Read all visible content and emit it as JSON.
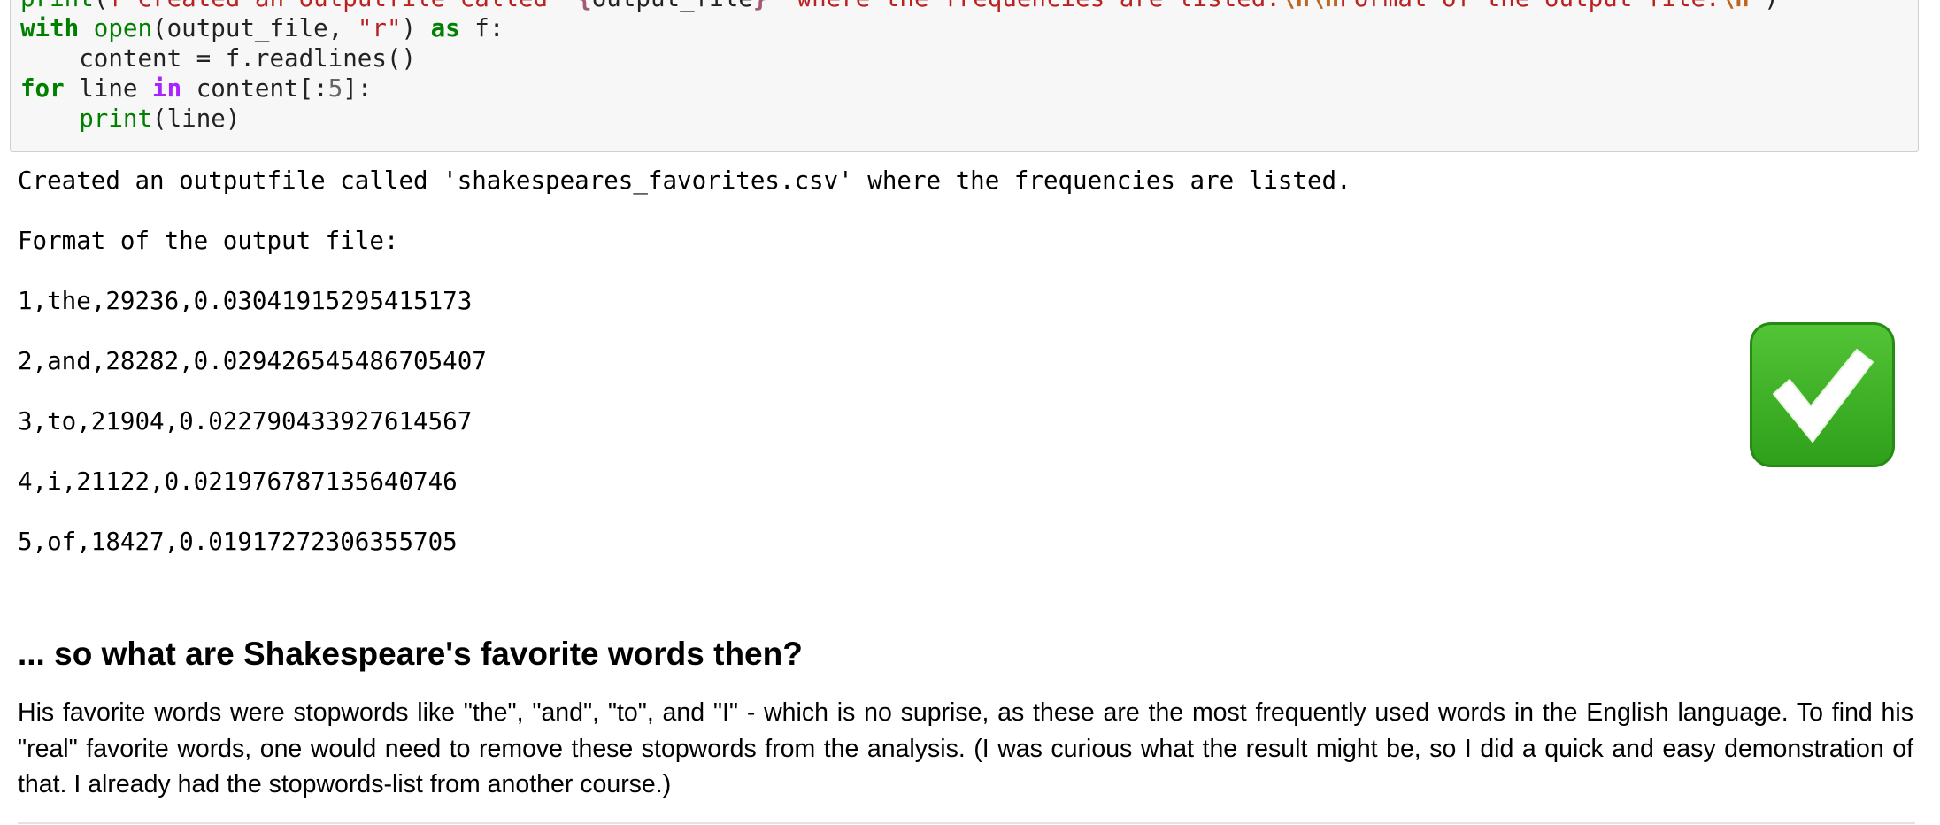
{
  "code_cell": {
    "line1": {
      "print_fn": "print",
      "paren_open": "(",
      "fstring_prefix": "f\"Created an outputfile called '",
      "interp_open": "{",
      "interp_var": "output_file",
      "interp_close": "}",
      "text_mid": "' where the frequencies are listed.",
      "escape_1": "\\n\\n",
      "text_end": "Format of the output file:",
      "escape_2": "\\n",
      "quote_close": "\"",
      "paren_close": ")"
    },
    "line2": {
      "kw_with": "with",
      "fn_open": "open",
      "args_a": "(output_file, ",
      "str_r": "\"r\"",
      "args_b": ") ",
      "kw_as": "as",
      "tail": " f:"
    },
    "line3": {
      "text": "    content = f.readlines()"
    },
    "line4": {
      "kw_for": "for",
      "mid": " line ",
      "kw_in": "in",
      "after_in": " content[:",
      "num": "5",
      "tail": "]:"
    },
    "line5": {
      "indent": "    ",
      "print_fn": "print",
      "args": "(line)"
    }
  },
  "output": {
    "line1": "Created an outputfile called 'shakespeares_favorites.csv' where the frequencies are listed.",
    "line2": "Format of the output file:",
    "rows": [
      "1,the,29236,0.03041915295415173",
      "2,and,28282,0.029426545486705407",
      "3,to,21904,0.022790433927614567",
      "4,i,21122,0.021976787135640746",
      "5,of,18427,0.01917272306355705"
    ]
  },
  "markdown": {
    "heading": "... so what are Shakespeare's favorite words then?",
    "paragraph": "His favorite words were stopwords like \"the\", \"and\", \"to\", and \"I\" - which is no suprise, as these are the most frequently used words in the English language. To find his \"real\" favorite words, one would need to remove these stopwords from the analysis. (I was curious what the result might be, so I did a quick and easy demonstration of that. I already had the stopwords-list from another course.)"
  },
  "icons": {
    "check": "check-mark-button-icon",
    "check_color": "#3cb028"
  }
}
